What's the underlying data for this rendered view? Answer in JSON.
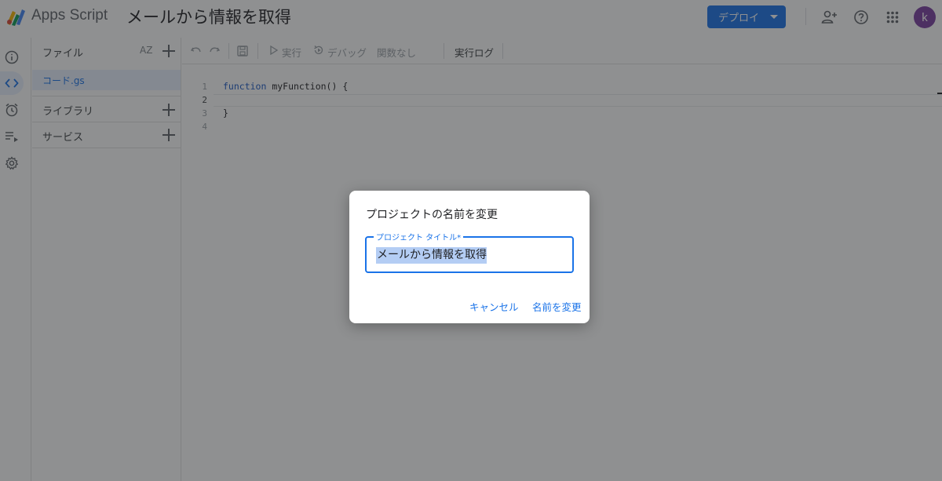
{
  "app": {
    "brand": "Apps Script",
    "project_title": "メールから情報を取得",
    "deploy_label": "デプロイ",
    "avatar_letter": "k"
  },
  "rail": {
    "icons": [
      "info-icon",
      "code-icon",
      "clock-icon",
      "executions-icon",
      "settings-icon"
    ]
  },
  "files": {
    "header": "ファイル",
    "sort_label": "AZ",
    "items": [
      {
        "label": "コード.gs"
      }
    ],
    "sections": [
      {
        "label": "ライブラリ"
      },
      {
        "label": "サービス"
      }
    ]
  },
  "toolbar": {
    "run": "実行",
    "debug": "デバッグ",
    "function_select": "関数なし",
    "log": "実行ログ"
  },
  "editor": {
    "line_numbers": [
      "1",
      "2",
      "3",
      "4"
    ],
    "keyword": "function",
    "line1_rest": " myFunction() {",
    "line3": "}"
  },
  "dialog": {
    "title": "プロジェクトの名前を変更",
    "field_label": "プロジェクト タイトル*",
    "field_value": "メールから情報を取得",
    "cancel": "キャンセル",
    "confirm": "名前を変更"
  },
  "colors": {
    "accent": "#1a73e8",
    "avatar": "#7b3fa0",
    "selection": "#b4cdf4"
  }
}
